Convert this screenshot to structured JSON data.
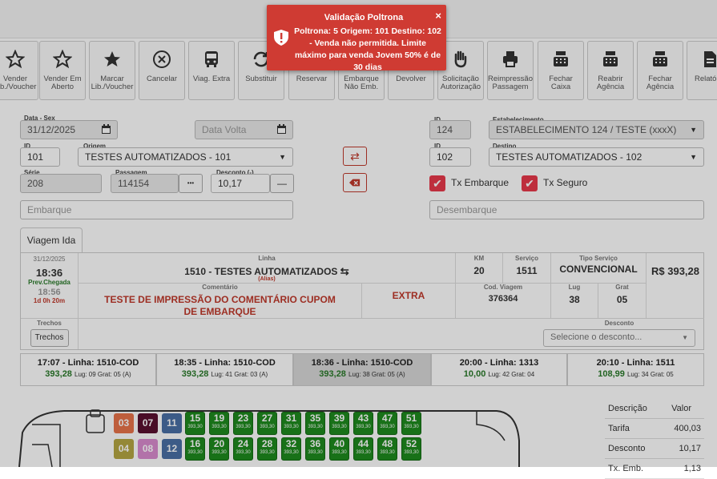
{
  "toolbar": {
    "buttons": [
      {
        "label": "Vender Lib./Voucher",
        "icon": "star-outline-icon"
      },
      {
        "label": "Vender Em Aberto",
        "icon": "star-outline-icon"
      },
      {
        "label": "Marcar Lib./Voucher",
        "icon": "star-filled-icon"
      },
      {
        "label": "Cancelar",
        "icon": "cancel-circle-icon"
      },
      {
        "label": "Viag. Extra",
        "icon": "bus-icon"
      },
      {
        "label": "Substituir",
        "icon": "refresh-icon"
      },
      {
        "label": "Reservar",
        "icon": "reserve-icon"
      },
      {
        "label": "Embarque Não Emb.",
        "icon": "boarding-icon"
      },
      {
        "label": "Devolver",
        "icon": "return-icon"
      },
      {
        "label": "Solicitação Autorização",
        "icon": "hand-icon"
      },
      {
        "label": "Reimpressão Passagem",
        "icon": "printer-icon"
      },
      {
        "label": "Fechar Caixa",
        "icon": "cash-register-icon"
      },
      {
        "label": "Reabrir Agência",
        "icon": "cash-register-icon"
      },
      {
        "label": "Fechar Agência",
        "icon": "cash-register-icon"
      },
      {
        "label": "Relatório",
        "icon": "document-icon"
      }
    ]
  },
  "form": {
    "data_label": "Data - Sex",
    "data_value": "31/12/2025",
    "data_volta_placeholder": "Data Volta",
    "id_label": "ID",
    "origem_id": "101",
    "origem_label": "Origem",
    "origem_value": "TESTES AUTOMATIZADOS - 101",
    "serie_label": "Série",
    "serie_value": "208",
    "passagem_label": "Passagem",
    "passagem_value": "114154",
    "desconto_label": "Desconto (-)",
    "desconto_value": "10,17",
    "embarque_placeholder": "Embarque",
    "estab_id_label": "ID",
    "estab_id": "124",
    "estab_label": "Estabelecimento",
    "estab_value": "ESTABELECIMENTO 124 / TESTE (xxxX)",
    "destino_id_label": "ID",
    "destino_id": "102",
    "destino_label": "Destino",
    "destino_value": "TESTES AUTOMATIZADOS - 102",
    "tx_embarque": "Tx Embarque",
    "tx_seguro": "Tx Seguro",
    "desembarque_placeholder": "Desembarque",
    "dots": "•••",
    "minus": "—"
  },
  "tab": {
    "label": "Viagem Ida"
  },
  "trip": {
    "date": "31/12/2025",
    "time": "18:36",
    "prev_label": "Prev.Chegada",
    "arrival": "18:56",
    "duration": "1d 0h 20m",
    "linha_label": "Linha",
    "linha_value": "1510 - TESTES AUTOMATIZADOS",
    "alias": "(Alias)",
    "km_label": "KM",
    "km_value": "20",
    "servico_label": "Serviço",
    "servico_value": "1511",
    "tipo_label": "Tipo Serviço",
    "tipo_value": "CONVENCIONAL",
    "price": "R$ 393,28",
    "comentario_label": "Comentário",
    "comentario_value": "TESTE DE IMPRESSÃO DO COMENTÁRIO CUPOM DE EMBARQUE",
    "extra": "EXTRA",
    "cod_label": "Cod. Viagem",
    "cod_value": "376364",
    "lug_label": "Lug",
    "lug_value": "38",
    "grat_label": "Grat",
    "grat_value": "05",
    "trechos_label": "Trechos",
    "trechos_button": "Trechos",
    "desconto_label": "Desconto",
    "desconto_select": "Selecione o desconto..."
  },
  "trips": [
    {
      "title": "17:07 - Linha: 1510-COD",
      "price": "393,28",
      "info": "Lug: 09 Grat: 05 (A)"
    },
    {
      "title": "18:35 - Linha: 1510-COD",
      "price": "393,28",
      "info": "Lug: 41 Grat: 03 (A)"
    },
    {
      "title": "18:36 - Linha: 1510-COD",
      "price": "393,28",
      "info": "Lug: 38 Grat: 05 (A)"
    },
    {
      "title": "20:00 - Linha: 1313",
      "price": "10,00",
      "info": "Lug: 42 Grat: 04"
    },
    {
      "title": "20:10 - Linha: 1511",
      "price": "108,99",
      "info": "Lug: 34 Grat: 05"
    }
  ],
  "seats": {
    "special": [
      {
        "n": "03",
        "color": "#e8734a"
      },
      {
        "n": "07",
        "color": "#5a1030"
      },
      {
        "n": "11",
        "color": "#4a6fa5"
      },
      {
        "n": "04",
        "color": "#b5a642"
      },
      {
        "n": "08",
        "color": "#d98ccf"
      },
      {
        "n": "12",
        "color": "#4a6fa5"
      }
    ],
    "row1": [
      "15",
      "19",
      "23",
      "27",
      "31",
      "35",
      "39",
      "43",
      "47",
      "51"
    ],
    "row2": [
      "16",
      "20",
      "24",
      "28",
      "32",
      "36",
      "40",
      "44",
      "48",
      "52"
    ],
    "price": "393,30"
  },
  "summary": {
    "col_desc": "Descrição",
    "col_valor": "Valor",
    "rows": [
      {
        "desc": "Tarifa",
        "valor": "400,03"
      },
      {
        "desc": "Desconto",
        "valor": "10,17"
      },
      {
        "desc": "Tx. Emb.",
        "valor": "1,13"
      }
    ]
  },
  "toast": {
    "title": "Validação Poltrona",
    "message": "Poltrona: 5 Origem: 101 Destino: 102 - Venda não permitida. Limite máximo para venda Jovem 50% é de 30 dias",
    "close": "×"
  }
}
